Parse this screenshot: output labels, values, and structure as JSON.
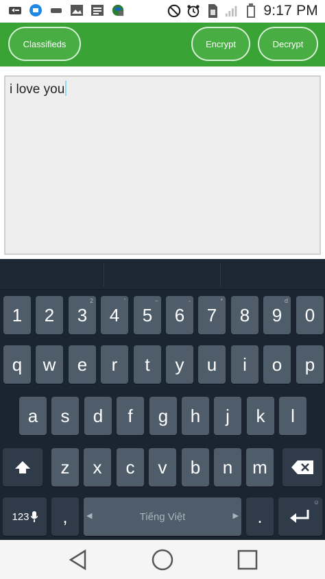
{
  "status_bar": {
    "time": "9:17 PM",
    "icons": [
      "ticker-icon",
      "messenger-icon",
      "signal-shape-icon",
      "image-icon",
      "document-icon",
      "globe-app-icon",
      "mute-icon",
      "alarm-icon",
      "sim-icon",
      "cell-signal-icon",
      "battery-icon"
    ]
  },
  "app_bar": {
    "classifieds_label": "Classifieds",
    "encrypt_label": "Encrypt",
    "decrypt_label": "Decrypt",
    "accent": "#3aa335"
  },
  "editor": {
    "text": "i love you"
  },
  "keyboard": {
    "number_row": [
      {
        "label": "1",
        "hint": ""
      },
      {
        "label": "2",
        "hint": ""
      },
      {
        "label": "3",
        "hint": "2"
      },
      {
        "label": "4",
        "hint": "'"
      },
      {
        "label": "5",
        "hint": "~"
      },
      {
        "label": "6",
        "hint": "-"
      },
      {
        "label": "7",
        "hint": "*"
      },
      {
        "label": "8",
        "hint": ""
      },
      {
        "label": "9",
        "hint": "d"
      },
      {
        "label": "0",
        "hint": ""
      }
    ],
    "row_q": [
      "q",
      "w",
      "e",
      "r",
      "t",
      "y",
      "u",
      "i",
      "o",
      "p"
    ],
    "row_a": [
      "a",
      "s",
      "d",
      "f",
      "g",
      "h",
      "j",
      "k",
      "l"
    ],
    "row_z": [
      "z",
      "x",
      "c",
      "v",
      "b",
      "n",
      "m"
    ],
    "symbols_label": "123",
    "comma_label": ",",
    "space_label": "Tiếng Việt",
    "period_label": ".",
    "bg": "#1b2431",
    "key_color": "#4f5d6b"
  },
  "nav_bar": {
    "icons": [
      "back-triangle-icon",
      "home-circle-icon",
      "recents-square-icon"
    ]
  }
}
